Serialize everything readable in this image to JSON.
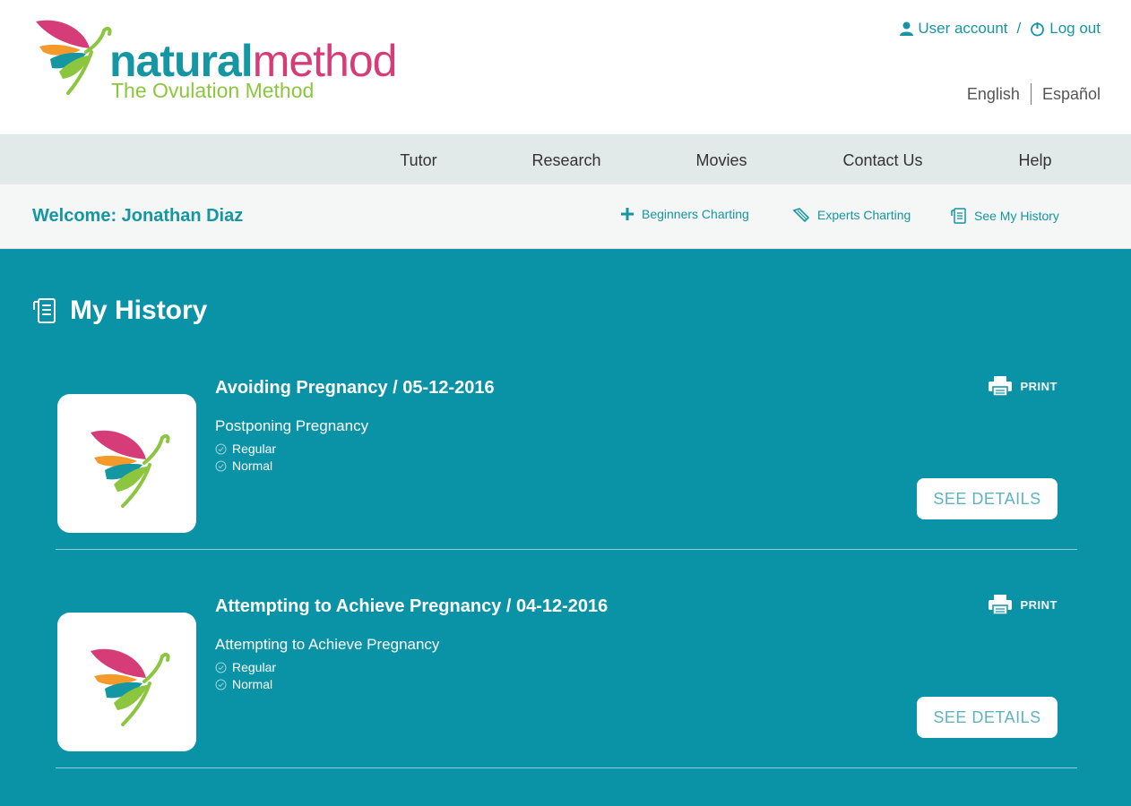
{
  "brand": {
    "name_part1": "natural",
    "name_part2": "method",
    "tagline": "The Ovulation Method",
    "colors": {
      "teal": "#1496a3",
      "pink": "#d63c78",
      "green": "#8cc63f",
      "orange": "#f39a2b"
    }
  },
  "account": {
    "user_label": "User account",
    "separator": "/",
    "logout_label": "Log out",
    "user_icon": "user-icon",
    "logout_icon": "power-icon"
  },
  "languages": [
    "English",
    "Español"
  ],
  "nav": {
    "items": [
      "Tutor",
      "Research",
      "Movies",
      "Contact Us",
      "Help"
    ]
  },
  "welcome": {
    "greeting": "Welcome: Jonathan Diaz",
    "actions": [
      {
        "label": "Beginners Charting",
        "icon": "plus-icon"
      },
      {
        "label": "Experts Charting",
        "icon": "pencil-icon"
      },
      {
        "label": "See My History",
        "icon": "history-icon"
      }
    ]
  },
  "main": {
    "title": "My History",
    "title_icon": "history-icon",
    "background": "#0a93a6",
    "records": [
      {
        "title": "Avoiding Pregnancy / 05-12-2016",
        "subtitle": "Postponing Pregnancy",
        "tags": [
          "Regular",
          "Normal"
        ],
        "print_label": "PRINT",
        "details_label": "SEE DETAILS"
      },
      {
        "title": "Attempting to Achieve Pregnancy / 04-12-2016",
        "subtitle": "Attempting to Achieve Pregnancy",
        "tags": [
          "Regular",
          "Normal"
        ],
        "print_label": "PRINT",
        "details_label": "SEE DETAILS"
      }
    ]
  }
}
